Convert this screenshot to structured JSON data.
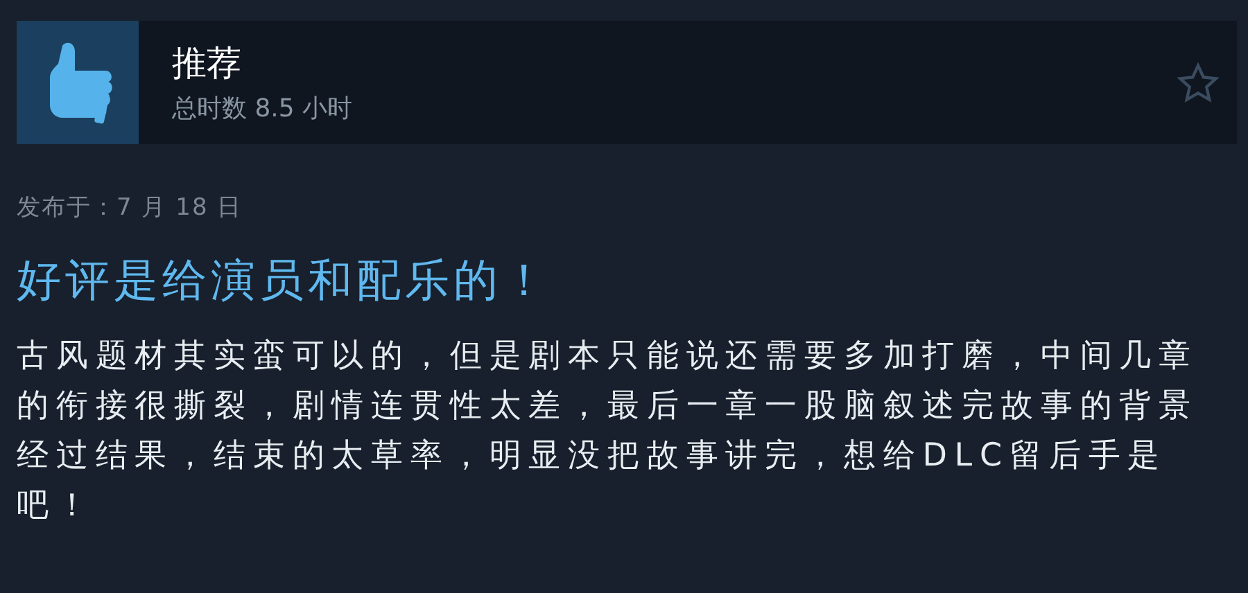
{
  "review": {
    "verdict": "推荐",
    "playtime": "总时数 8.5 小时",
    "posted": "发布于：7 月 18 日",
    "headline": "好评是给演员和配乐的！",
    "body": "古风题材其实蛮可以的，但是剧本只能说还需要多加打磨，中间几章的衔接很撕裂，剧情连贯性太差，最后一章一股脑叙述完故事的背景经过结果，结束的太草率，明显没把故事讲完，想给DLC留后手是吧！"
  }
}
